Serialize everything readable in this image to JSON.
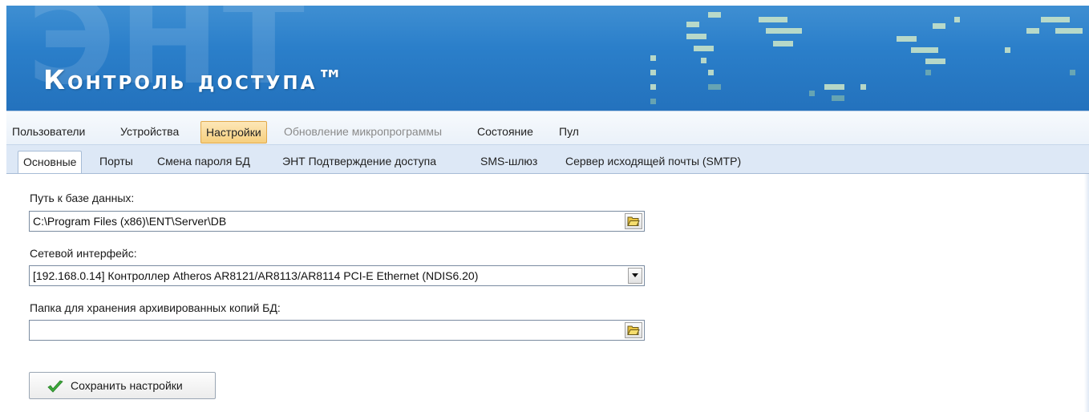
{
  "banner": {
    "watermark": "ЭНТ",
    "logo": "Контроль доступа™"
  },
  "main_tabs": [
    {
      "label": "Пользователи",
      "state": "normal"
    },
    {
      "label": "Устройства",
      "state": "normal"
    },
    {
      "label": "Настройки",
      "state": "active"
    },
    {
      "label": "Обновление микропрограммы",
      "state": "disabled"
    },
    {
      "label": "Состояние",
      "state": "normal"
    },
    {
      "label": "Пул",
      "state": "normal"
    }
  ],
  "sub_tabs": [
    {
      "label": "Основные",
      "state": "active"
    },
    {
      "label": "Порты",
      "state": "normal"
    },
    {
      "label": "Смена пароля БД",
      "state": "normal"
    },
    {
      "label": "ЭНТ Подтверждение доступа",
      "state": "normal"
    },
    {
      "label": "SMS-шлюз",
      "state": "normal"
    },
    {
      "label": "Сервер исходящей почты (SMTP)",
      "state": "normal"
    }
  ],
  "form": {
    "db_path_label": "Путь к базе данных:",
    "db_path_value": "C:\\Program Files (x86)\\ENT\\Server\\DB",
    "network_label": "Сетевой интерфейс:",
    "network_value": "[192.168.0.14] Контроллер Atheros AR8121/AR8113/AR8114 PCI-E Ethernet (NDIS6.20)",
    "backup_label": "Папка для хранения архивированных копий БД:",
    "backup_value": "",
    "save_label": "Сохранить настройки"
  },
  "icons": {
    "browse": "folder-open-icon",
    "dropdown": "chevron-down-icon",
    "save": "checkmark-icon"
  },
  "colors": {
    "banner": "#2b7fca",
    "active_tab": "#f6cf7e",
    "checkmark": "#3cab3a"
  }
}
